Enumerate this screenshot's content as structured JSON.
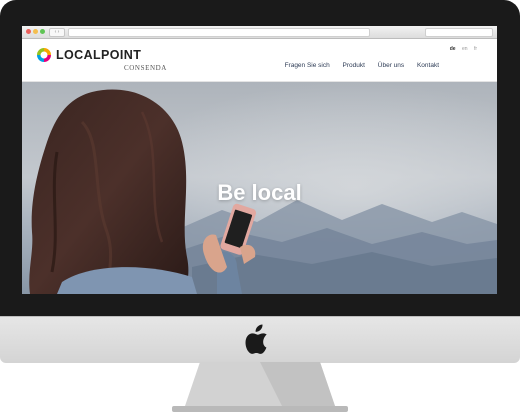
{
  "site": {
    "logo_text": "LOCALPOINT",
    "logo_sub": "CONSENDA",
    "languages": [
      {
        "label": "de",
        "active": true
      },
      {
        "label": "en",
        "active": false
      },
      {
        "label": "fr",
        "active": false
      }
    ],
    "nav": [
      "Fragen Sie sich",
      "Produkt",
      "Über uns",
      "Kontakt"
    ]
  },
  "hero": {
    "title": "Be local"
  },
  "icons": {
    "brand_logo": "localpoint-logo-icon",
    "device_logo": "apple-icon"
  },
  "colors": {
    "monitor_bezel": "#1a1a1a",
    "nav_text": "#2d3b55",
    "hero_text": "#ffffff"
  }
}
